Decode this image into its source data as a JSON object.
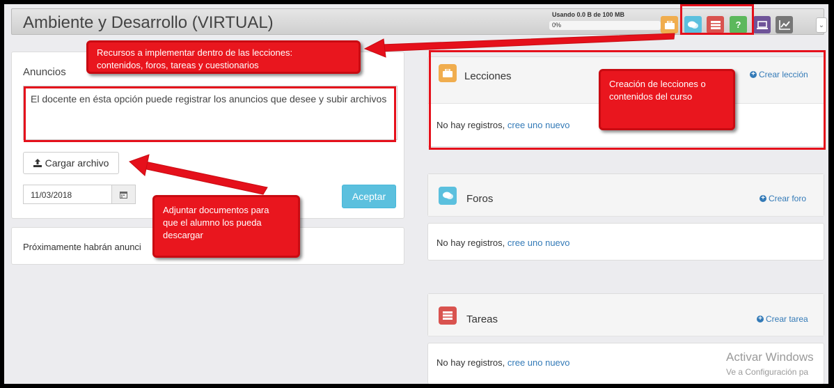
{
  "header": {
    "title": "Ambiente y Desarrollo (VIRTUAL)",
    "usage_label": "Usando 0.0 B de 100 MB",
    "usage_percent": "0%",
    "usage_fraction": 0.0
  },
  "toolbar": {
    "buttons": [
      {
        "name": "lecciones",
        "icon": "briefcase-icon",
        "color": "#f0ad4e"
      },
      {
        "name": "foros",
        "icon": "comments-icon",
        "color": "#5bc0de"
      },
      {
        "name": "tareas",
        "icon": "tasks-icon",
        "color": "#d9534f"
      },
      {
        "name": "cuestionarios",
        "icon": "question-icon",
        "label": "?",
        "color": "#5cb85c"
      },
      {
        "name": "virtual",
        "icon": "laptop-icon",
        "color": "#6f5499"
      },
      {
        "name": "estadisticas",
        "icon": "chart-icon",
        "color": "#777777"
      }
    ],
    "dropdown_icon": "chevron-down-icon"
  },
  "announcements": {
    "heading": "Anuncios",
    "text": "El docente en ésta opción puede registrar los anuncios que desee y subir archivos",
    "upload_button": "Cargar archivo",
    "date_value": "11/03/2018",
    "accept_button": "Aceptar",
    "coming_soon": "Próximamente habrán anunci"
  },
  "sections": {
    "lecciones": {
      "title": "Lecciones",
      "link": "Crear lección",
      "empty_text": "No hay registros,",
      "empty_link": "cree uno nuevo",
      "color": "#f0ad4e"
    },
    "foros": {
      "title": "Foros",
      "link": "Crear foro",
      "empty_text": "No hay registros,",
      "empty_link": "cree uno nuevo",
      "color": "#5bc0de"
    },
    "tareas": {
      "title": "Tareas",
      "link": "Crear tarea",
      "empty_text": "No hay registros,",
      "empty_link": "cree uno nuevo",
      "color": "#d9534f"
    }
  },
  "callouts": {
    "resources": [
      "Recursos a implementar dentro de las lecciones:",
      "contenidos, foros, tareas y cuestionarios"
    ],
    "lessons": [
      "Creación de lecciones o",
      "contenidos del curso"
    ],
    "attach": [
      "Adjuntar documentos para",
      "que el alumno los pueda",
      "descargar"
    ]
  },
  "watermark": {
    "line1": "Activar Windows",
    "line2": "Ve a Configuración pa"
  },
  "colors": {
    "callout_red": "#e9161e",
    "link_blue": "#337ab7",
    "accept_blue": "#5bc0de"
  }
}
